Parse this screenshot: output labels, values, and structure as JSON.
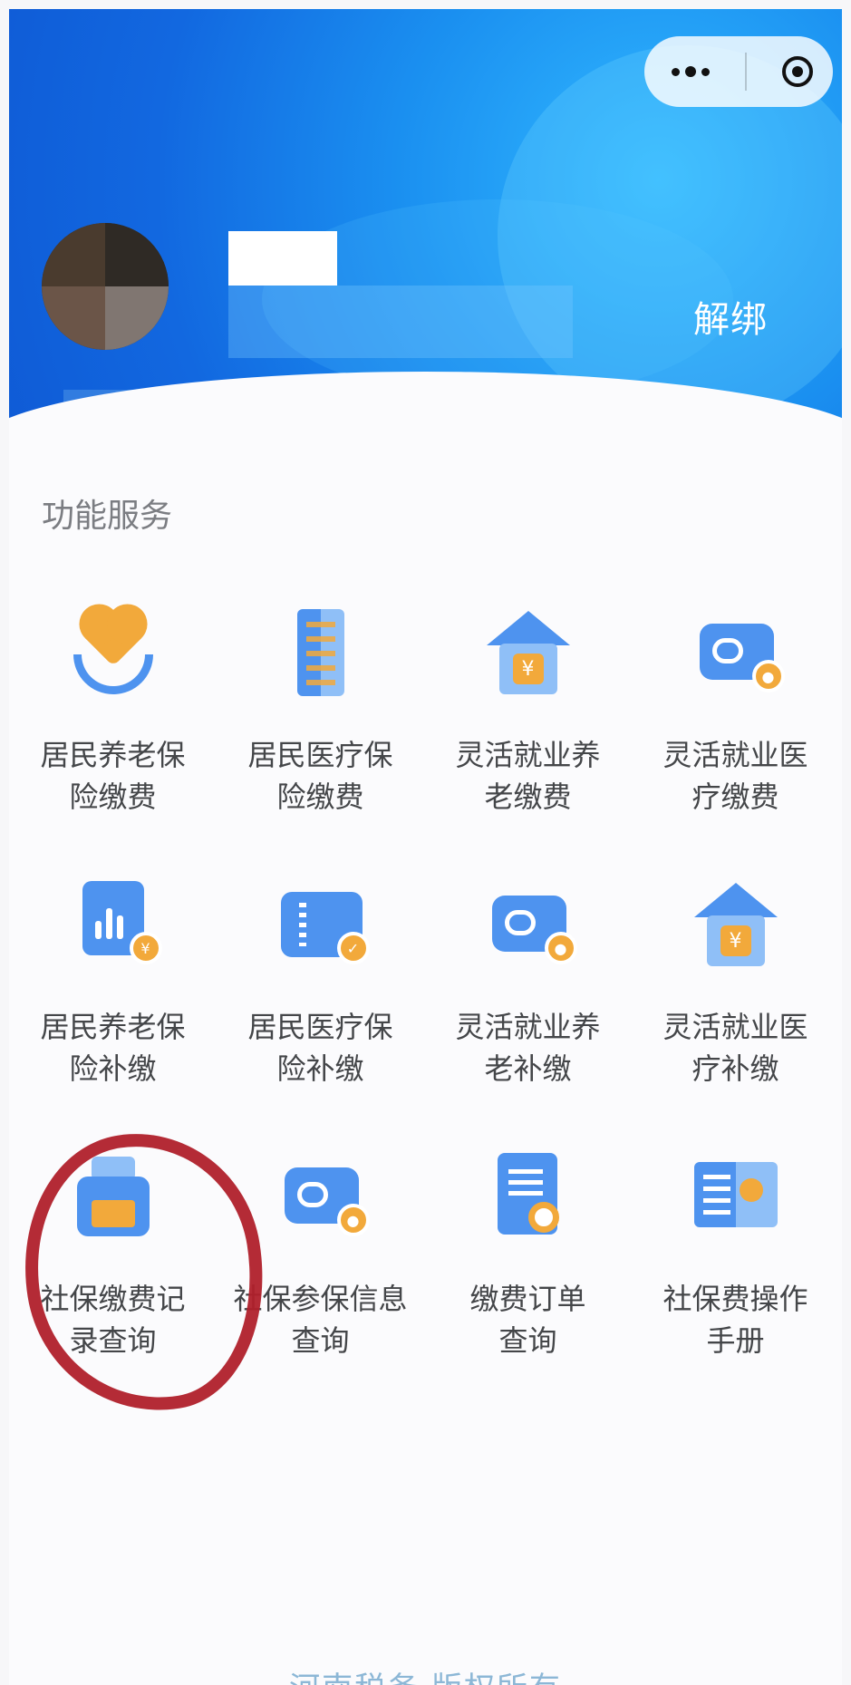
{
  "header": {
    "unbind_label": "解绑",
    "capsule": {
      "more_icon": "more-dots-icon",
      "close_icon": "target-circle-icon"
    }
  },
  "services": {
    "section_title": "功能服务",
    "items": [
      {
        "label": "居民养老保\n险缴费",
        "icon": "hands-heart-icon"
      },
      {
        "label": "居民医疗保\n险缴费",
        "icon": "building-icon"
      },
      {
        "label": "灵活就业养\n老缴费",
        "icon": "house-yuan-icon"
      },
      {
        "label": "灵活就业医\n疗缴费",
        "icon": "card-user-icon"
      },
      {
        "label": "居民养老保\n险补缴",
        "icon": "chart-yuan-icon"
      },
      {
        "label": "居民医疗保\n险补缴",
        "icon": "ticket-check-icon"
      },
      {
        "label": "灵活就业养\n老补缴",
        "icon": "card-user-icon"
      },
      {
        "label": "灵活就业医\n疗补缴",
        "icon": "house-yuan-icon"
      },
      {
        "label": "社保缴费记\n录查询",
        "icon": "printer-icon"
      },
      {
        "label": "社保参保信息\n查询",
        "icon": "card-user-icon"
      },
      {
        "label": "缴费订单\n查询",
        "icon": "document-search-icon"
      },
      {
        "label": "社保费操作\n手册",
        "icon": "book-key-icon"
      }
    ]
  },
  "footer": {
    "text": "河南税务 版权所有"
  },
  "colors": {
    "primary_blue": "#4e93ef",
    "light_blue": "#8fbff7",
    "accent_orange": "#f2a93b",
    "annotation_red": "#b0202b"
  }
}
